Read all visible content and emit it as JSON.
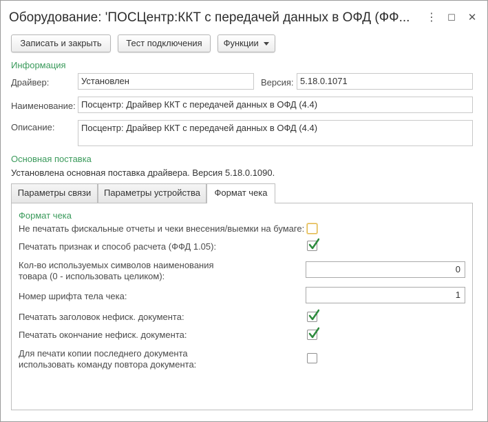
{
  "window": {
    "title": "Оборудование: 'ПОСЦентр:ККТ с передачей данных в ОФД (ФФ...",
    "more_icon": "⋮",
    "maximize_icon": "☐",
    "close_icon": "✕"
  },
  "toolbar": {
    "save_close": "Записать и закрыть",
    "test_connection": "Тест подключения",
    "functions": "Функции"
  },
  "info": {
    "section_title": "Информация",
    "driver_label": "Драйвер:",
    "driver_value": "Установлен",
    "version_label": "Версия:",
    "version_value": "5.18.0.1071",
    "name_label": "Наименование:",
    "name_value": "Посцентр: Драйвер ККТ с передачей данных в ОФД (4.4)",
    "description_label": "Описание:",
    "description_value": "Посцентр: Драйвер ККТ с передачей данных в ОФД (4.4)"
  },
  "supply": {
    "section_title": "Основная поставка",
    "text": "Установлена основная поставка драйвера. Версия 5.18.0.1090."
  },
  "tabs": [
    {
      "label": "Параметры связи",
      "active": false
    },
    {
      "label": "Параметры устройства",
      "active": false
    },
    {
      "label": "Формат чека",
      "active": true
    }
  ],
  "receipt_format": {
    "section_title": "Формат чека",
    "no_print_fiscal_label": "Не печатать фискальные отчеты и чеки внесения/выемки на бумаге:",
    "no_print_fiscal_checked": false,
    "print_sign_label": "Печатать признак и способ расчета (ФФД 1.05):",
    "print_sign_checked": true,
    "symbols_label_line1": "Кол-во используемых символов наименования",
    "symbols_label_line2": "товара (0 - использовать целиком):",
    "symbols_value": "0",
    "font_label": "Номер шрифта тела чека:",
    "font_value": "1",
    "print_header_label": "Печатать заголовок нефиск. документа:",
    "print_header_checked": true,
    "print_footer_label": "Печатать окончание нефиск. документа:",
    "print_footer_checked": true,
    "repeat_cmd_label_line1": "Для печати копии последнего документа",
    "repeat_cmd_label_line2": "использовать команду повтора документа:",
    "repeat_cmd_checked": false
  },
  "colors": {
    "section_green": "#3a9a5b",
    "check_green": "#2e8b3e",
    "focus_border": "#e0b84c"
  }
}
